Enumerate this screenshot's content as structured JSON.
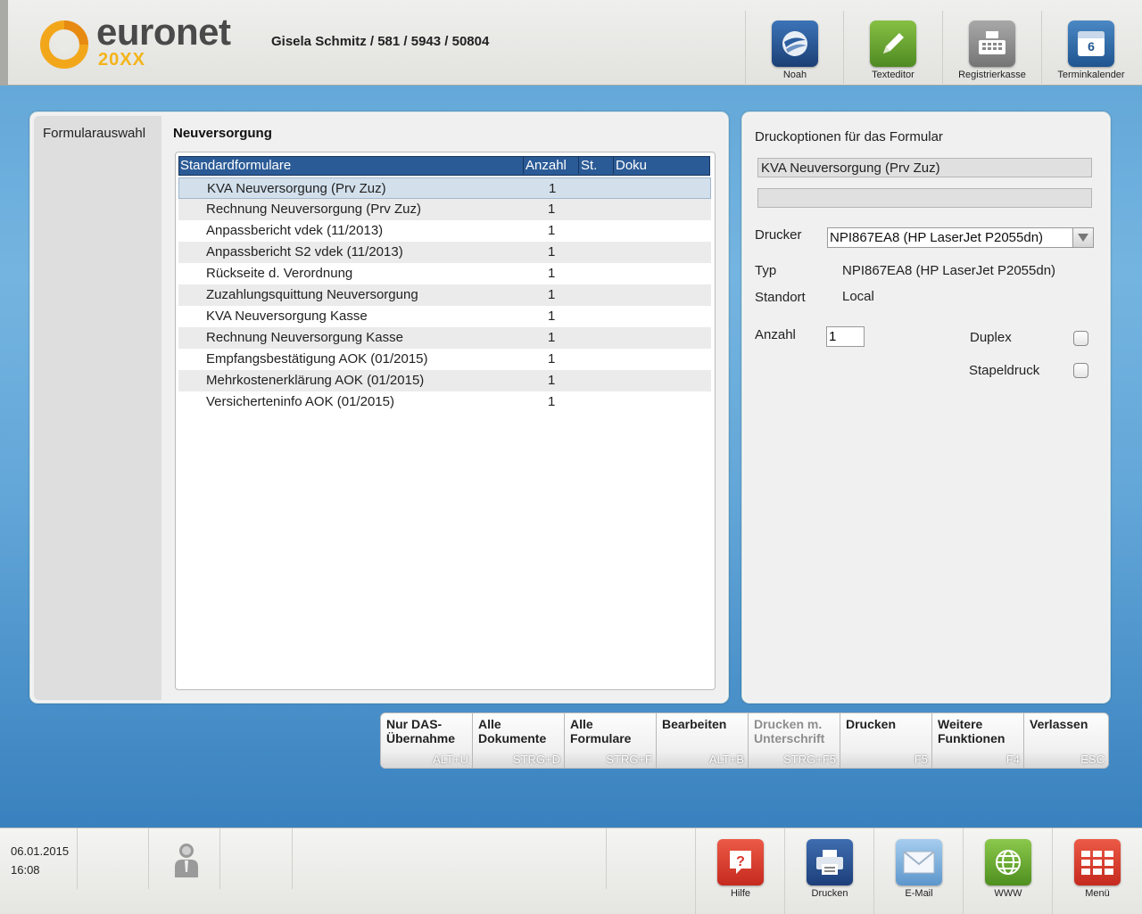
{
  "header": {
    "logo_word": "euronet",
    "logo_year": "20XX",
    "patient": "Gisela Schmitz / 581 / 5943 / 50804",
    "buttons": [
      {
        "label": "Noah",
        "icon": "noah-icon",
        "color": "#1f4f8f"
      },
      {
        "label": "Texteditor",
        "icon": "pencil-icon",
        "color": "#6aa331"
      },
      {
        "label": "Registrierkasse",
        "icon": "cash-register-icon",
        "color": "#8d8d8d"
      },
      {
        "label": "Terminkalender",
        "icon": "calendar-icon",
        "color": "#2f6aa3"
      }
    ],
    "calendar_day": "6"
  },
  "left": {
    "side_label": "Formularauswahl",
    "section_title": "Neuversorgung",
    "columns": [
      "Standardformulare",
      "Anzahl",
      "St.",
      "Doku"
    ],
    "rows": [
      {
        "name": "KVA Neuversorgung (Prv Zuz)",
        "count": "1",
        "selected": true
      },
      {
        "name": "Rechnung Neuversorgung (Prv Zuz)",
        "count": "1"
      },
      {
        "name": "Anpassbericht vdek (11/2013)",
        "count": "1"
      },
      {
        "name": "Anpassbericht S2 vdek (11/2013)",
        "count": "1"
      },
      {
        "name": "Rückseite d. Verordnung",
        "count": "1"
      },
      {
        "name": "Zuzahlungsquittung Neuversorgung",
        "count": "1"
      },
      {
        "name": "KVA Neuversorgung Kasse",
        "count": "1"
      },
      {
        "name": "Rechnung Neuversorgung Kasse",
        "count": "1"
      },
      {
        "name": "Empfangsbestätigung AOK (01/2015)",
        "count": "1"
      },
      {
        "name": "Mehrkostenerklärung AOK (01/2015)",
        "count": "1"
      },
      {
        "name": "Versicherteninfo AOK (01/2015)",
        "count": "1"
      }
    ]
  },
  "right": {
    "title": "Druckoptionen für das Formular",
    "form_name": "KVA Neuversorgung (Prv Zuz)",
    "form_extra": "",
    "drucker_label": "Drucker",
    "drucker_value": "NPI867EA8 (HP LaserJet P2055dn)",
    "typ_label": "Typ",
    "typ_value": "NPI867EA8 (HP LaserJet P2055dn)",
    "standort_label": "Standort",
    "standort_value": "Local",
    "anzahl_label": "Anzahl",
    "anzahl_value": "1",
    "duplex_label": "Duplex",
    "duplex_checked": false,
    "stapel_label": "Stapeldruck",
    "stapel_checked": false
  },
  "actions": [
    {
      "label": "Nur DAS-\nÜbernahme",
      "key": "ALT+U",
      "enabled": true
    },
    {
      "label": "Alle\nDokumente",
      "key": "STRG+D",
      "enabled": true
    },
    {
      "label": "Alle\nFormulare",
      "key": "STRG+F",
      "enabled": true
    },
    {
      "label": "Bearbeiten",
      "key": "ALT+B",
      "enabled": true
    },
    {
      "label": "Drucken m.\nUnterschrift",
      "key": "STRG+F5",
      "enabled": false
    },
    {
      "label": "Drucken",
      "key": "F5",
      "enabled": true
    },
    {
      "label": "Weitere\nFunktionen",
      "key": "F4",
      "enabled": true
    },
    {
      "label": "Verlassen",
      "key": "ESC",
      "enabled": true
    }
  ],
  "footer": {
    "date": "06.01.2015",
    "time": "16:08",
    "buttons": [
      {
        "label": "Hilfe",
        "icon": "help-icon",
        "color": "#d9352b"
      },
      {
        "label": "Drucken",
        "icon": "printer-icon",
        "color": "#2a4f8c"
      },
      {
        "label": "E-Mail",
        "icon": "mail-icon",
        "color": "#79aedd"
      },
      {
        "label": "WWW",
        "icon": "globe-icon",
        "color": "#6aab2f"
      },
      {
        "label": "Menü",
        "icon": "menu-grid-icon",
        "color": "#d9352b"
      }
    ]
  }
}
